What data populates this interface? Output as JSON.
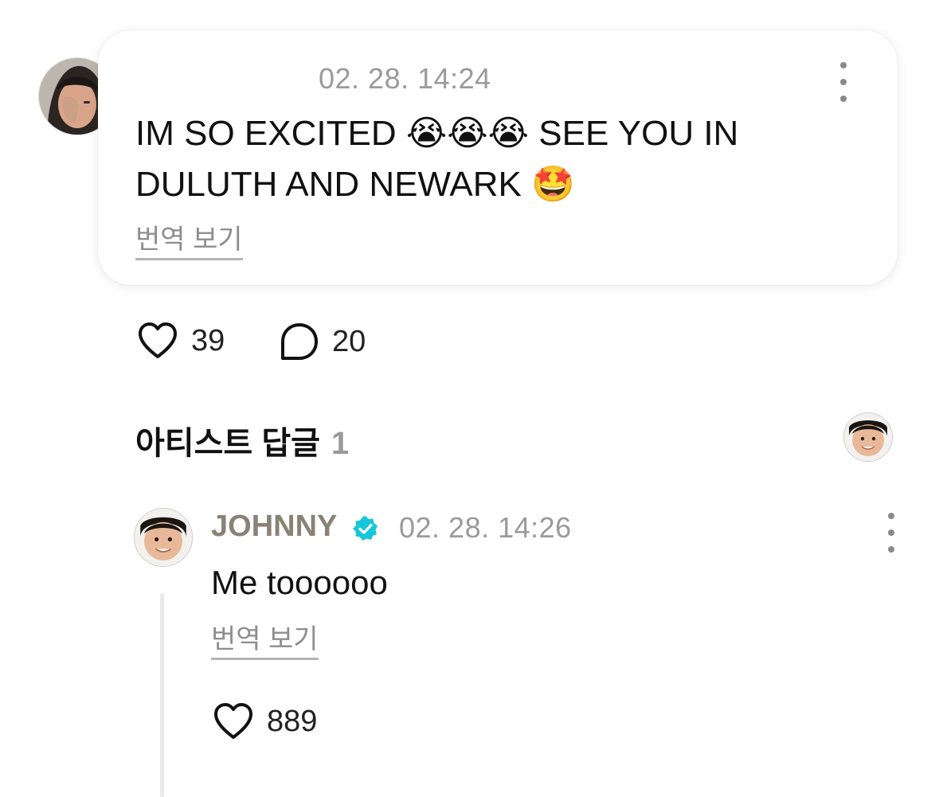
{
  "post": {
    "timestamp": "02. 28. 14:24",
    "text": "IM SO EXCITED 😭😭😭 SEE YOU IN\nDULUTH AND NEWARK 🤩",
    "translate_label": "번역 보기",
    "likes": "39",
    "comments": "20",
    "avatar_icon": "user-avatar-photo"
  },
  "artist_replies": {
    "title": "아티스트 답글",
    "count": "1"
  },
  "reply": {
    "author": "JOHNNY",
    "verified_color": "#16c7d9",
    "timestamp": "02. 28. 14:26",
    "text": "Me toooooo",
    "translate_label": "번역 보기",
    "likes": "889"
  },
  "icons": {
    "heart": "heart-icon",
    "comment": "comment-bubble-icon",
    "more": "more-vertical-icon",
    "verified": "verified-badge-icon"
  }
}
